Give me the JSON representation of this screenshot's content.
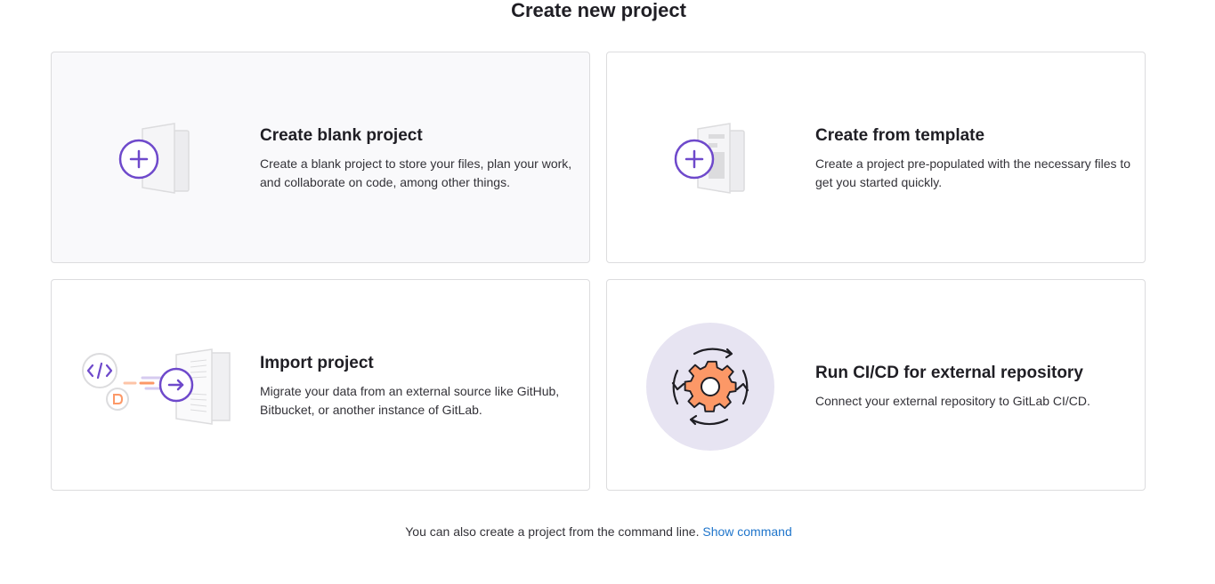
{
  "page": {
    "title": "Create new project"
  },
  "cards": [
    {
      "title": "Create blank project",
      "description": "Create a blank project to store your files, plan your work, and collaborate on code, among other things."
    },
    {
      "title": "Create from template",
      "description": "Create a project pre-populated with the necessary files to get you started quickly."
    },
    {
      "title": "Import project",
      "description": "Migrate your data from an external source like GitHub, Bitbucket, or another instance of GitLab."
    },
    {
      "title": "Run CI/CD for external repository",
      "description": "Connect your external repository to GitLab CI/CD."
    }
  ],
  "footer": {
    "text": "You can also create a project from the command line.",
    "link": "Show command"
  },
  "icons": {
    "blank": "file-plus-illustration-icon",
    "template": "template-plus-illustration-icon",
    "import": "import-arrow-illustration-icon",
    "cicd": "gear-cycle-illustration-icon"
  },
  "colors": {
    "accent_purple": "#6e49cb",
    "gear_orange": "#fc9867",
    "link_blue": "#1f75cb",
    "card_border": "#dcdcde",
    "active_card_bg": "#f9f9fb"
  }
}
